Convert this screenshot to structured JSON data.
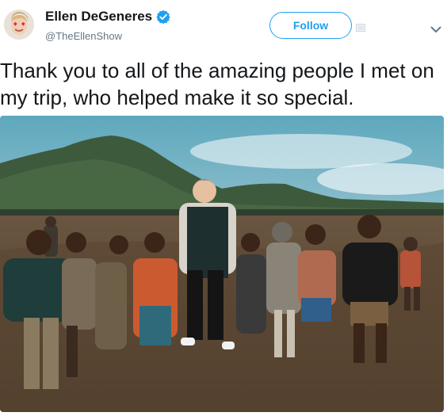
{
  "tweet": {
    "author_name": "Ellen DeGeneres",
    "handle": "@TheEllenShow",
    "follow_label": "Follow",
    "text": "Thank you to all of the amazing people I met on my trip, who helped make it so special."
  },
  "icons": {
    "verified": "verified-badge-icon",
    "more": "chevron-down-icon",
    "media": "image-icon"
  },
  "colors": {
    "accent": "#1da1f2",
    "secondary_text": "#657786",
    "primary_text": "#14171a"
  }
}
